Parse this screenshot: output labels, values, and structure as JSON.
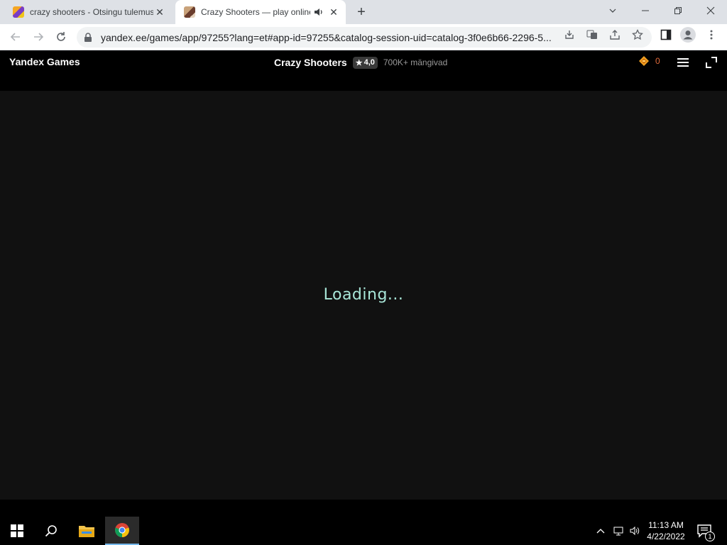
{
  "browser": {
    "tabs": [
      {
        "title": "crazy shooters - Otsingu tulemus",
        "icon": "yandex-search-favicon"
      },
      {
        "title": "Crazy Shooters — play online",
        "icon": "game-favicon",
        "audio_icon": "speaker-icon"
      }
    ],
    "new_tab_label": "+",
    "url": "yandex.ee/games/app/97255?lang=et#app-id=97255&catalog-session-uid=catalog-3f0e6b66-2296-5..."
  },
  "site": {
    "logo": "Yandex Games",
    "game_title": "Crazy Shooters",
    "rating": "4,0",
    "rating_star": "★",
    "players": "700K+ mängivad",
    "coins": "0"
  },
  "game": {
    "loading_text": "Loading..."
  },
  "taskbar": {
    "time": "11:13 AM",
    "date": "4/22/2022",
    "notification_count": "1"
  },
  "colors": {
    "loading_text": "#a8e6d8",
    "coin_count": "#e06a3a",
    "game_background": "#111111",
    "header_background": "#000000"
  }
}
